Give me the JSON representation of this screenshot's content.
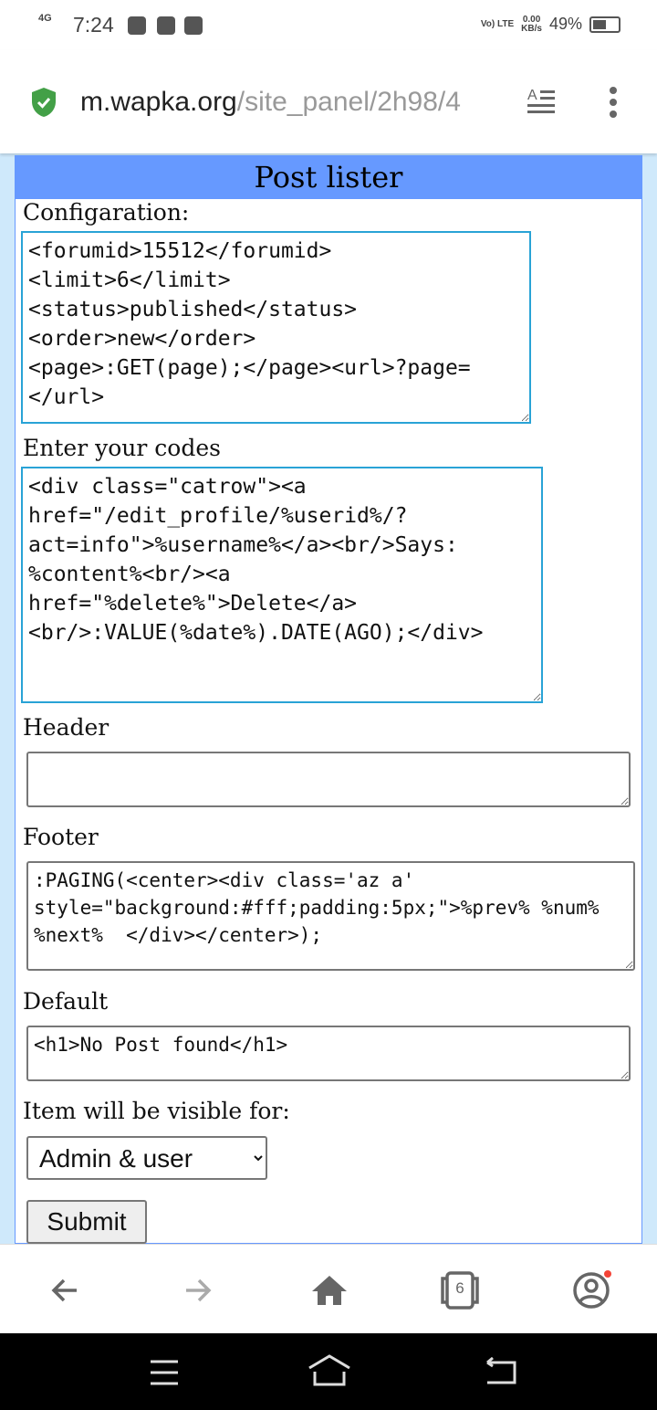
{
  "status_bar": {
    "network": "4G",
    "time": "7:24",
    "volte": "Vo) LTE",
    "speed": "0.00",
    "speed_unit": "KB/s",
    "battery": "49%",
    "battery_level": 0.49
  },
  "browser": {
    "url_domain": "m.wapka.org",
    "url_path": "/site_panel/2h98/4",
    "tab_count": "6",
    "accent": "#6699ff"
  },
  "form": {
    "title": "Post lister",
    "config_label": "Configaration:",
    "config_value": "<forumid>15512</forumid>\n<limit>6</limit>\n<status>published</status>\n<order>new</order>\n<page>:GET(page);</page><url>?page=</url>",
    "codes_label": "Enter your codes",
    "codes_value": "<div class=\"catrow\"><a href=\"/edit_profile/%userid%/?act=info\">%username%</a><br/>Says: %content%<br/><a href=\"%delete%\">Delete</a><br/>:VALUE(%date%).DATE(AGO);</div>",
    "header_label": "Header",
    "header_value": "",
    "footer_label": "Footer",
    "footer_value": ":PAGING(<center><div class='az a' style=\"background:#fff;padding:5px;\">%prev% %num% %next%  </div></center>);",
    "default_label": "Default",
    "default_value": "<h1>No Post found</h1>",
    "visibility_label": "Item will be visible for:",
    "visibility_selected": "Admin & user",
    "submit_label": "Submit"
  }
}
